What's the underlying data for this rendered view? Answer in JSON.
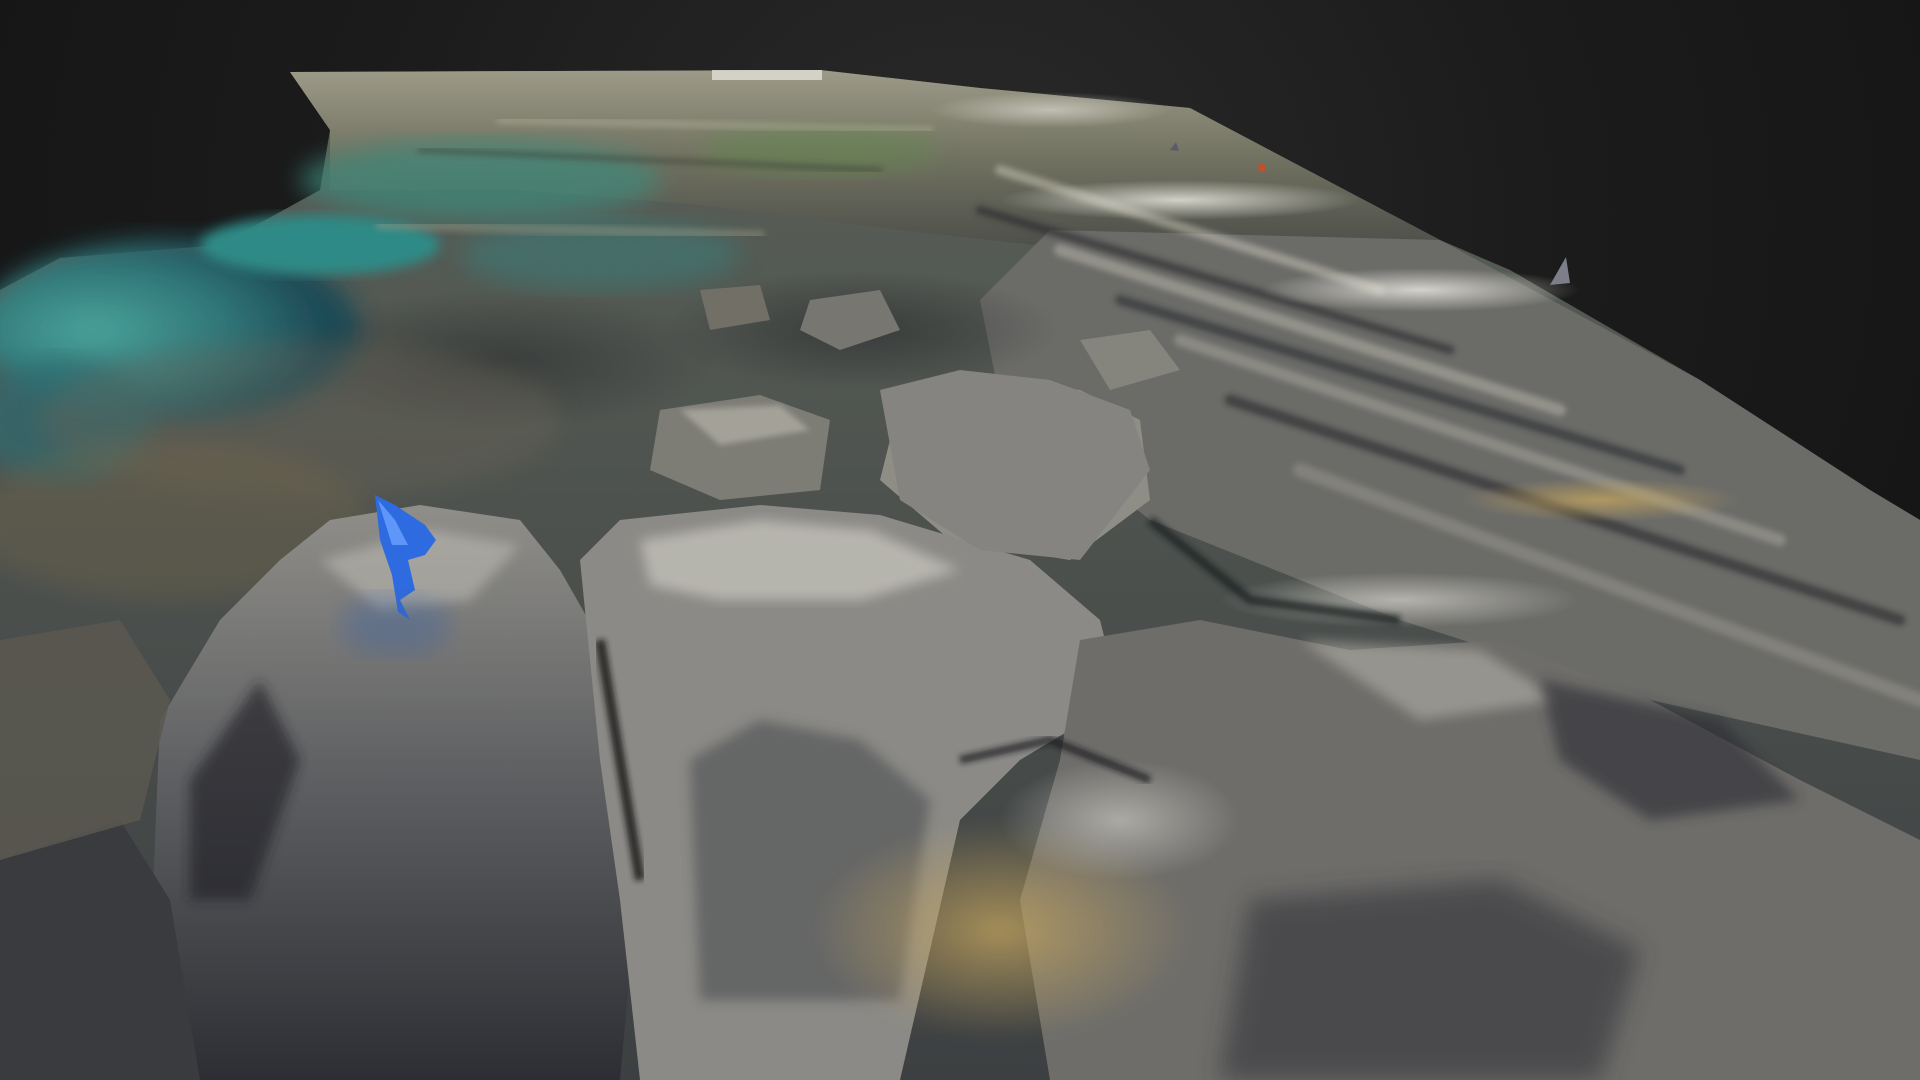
{
  "viewer": {
    "background_color": "#151515",
    "content": "3d-terrain-model"
  },
  "scene": {
    "subject": "coastal-rock-platform",
    "palette": {
      "rock_light": "#c9c7bd",
      "rock_mid": "#7b7a74",
      "rock_dark": "#2c2d30",
      "rock_warm": "#b39a62",
      "water": "#3f8c88",
      "water_deep": "#1e5a66",
      "moss": "#6f8a3a",
      "marker": "#2f6be0"
    }
  },
  "marker": {
    "icon": "location-pin-icon",
    "color": "#2f6be0"
  }
}
